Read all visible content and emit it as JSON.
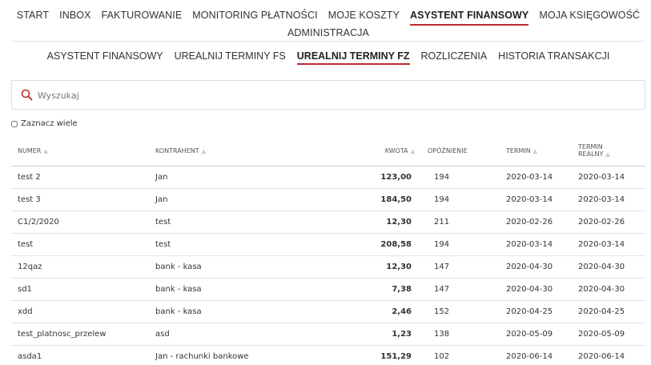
{
  "top_nav": {
    "row1": [
      "START",
      "INBOX",
      "FAKTUROWANIE",
      "MONITORING PŁATNOŚCI",
      "MOJE KOSZTY",
      "ASYSTENT FINANSOWY",
      "MOJA KSIĘGOWOŚĆ"
    ],
    "row2": [
      "ADMINISTRACJA"
    ],
    "active": "ASYSTENT FINANSOWY"
  },
  "sub_nav": {
    "items": [
      "ASYSTENT FINANSOWY",
      "UREALNIJ TERMINY FS",
      "UREALNIJ TERMINY FZ",
      "ROZLICZENIA",
      "HISTORIA TRANSAKCJI"
    ],
    "active": "UREALNIJ TERMINY FZ"
  },
  "search": {
    "placeholder": "Wyszukaj",
    "value": ""
  },
  "select_many_label": "Zaznacz wiele",
  "table": {
    "headers": {
      "numer": "NUMER",
      "kontrahent": "KONTRAHENT",
      "kwota": "KWOTA",
      "opoznienie": "OPÓŹNIENIE",
      "termin": "TERMIN",
      "termin_realny_1": "TERMIN",
      "termin_realny_2": "REALNY"
    },
    "rows": [
      {
        "numer": "test 2",
        "kontrahent": "Jan",
        "kwota": "123,00",
        "opoznienie": "194",
        "termin": "2020-03-14",
        "termin_realny": "2020-03-14"
      },
      {
        "numer": "test 3",
        "kontrahent": "Jan",
        "kwota": "184,50",
        "opoznienie": "194",
        "termin": "2020-03-14",
        "termin_realny": "2020-03-14"
      },
      {
        "numer": "C1/2/2020",
        "kontrahent": "test",
        "kwota": "12,30",
        "opoznienie": "211",
        "termin": "2020-02-26",
        "termin_realny": "2020-02-26"
      },
      {
        "numer": "test",
        "kontrahent": "test",
        "kwota": "208,58",
        "opoznienie": "194",
        "termin": "2020-03-14",
        "termin_realny": "2020-03-14"
      },
      {
        "numer": "12qaz",
        "kontrahent": "bank - kasa",
        "kwota": "12,30",
        "opoznienie": "147",
        "termin": "2020-04-30",
        "termin_realny": "2020-04-30"
      },
      {
        "numer": "sd1",
        "kontrahent": "bank - kasa",
        "kwota": "7,38",
        "opoznienie": "147",
        "termin": "2020-04-30",
        "termin_realny": "2020-04-30"
      },
      {
        "numer": "xdd",
        "kontrahent": "bank - kasa",
        "kwota": "2,46",
        "opoznienie": "152",
        "termin": "2020-04-25",
        "termin_realny": "2020-04-25"
      },
      {
        "numer": "test_platnosc_przelew",
        "kontrahent": "asd",
        "kwota": "1,23",
        "opoznienie": "138",
        "termin": "2020-05-09",
        "termin_realny": "2020-05-09"
      },
      {
        "numer": "asda1",
        "kontrahent": "Jan - rachunki bankowe",
        "kwota": "151,29",
        "opoznienie": "102",
        "termin": "2020-06-14",
        "termin_realny": "2020-06-14"
      }
    ]
  },
  "colors": {
    "accent": "#c0282d",
    "search_icon": "#c0282d",
    "border": "#dcdcdc"
  },
  "icons": {
    "search": "search-icon",
    "sort": "sort-icon"
  }
}
